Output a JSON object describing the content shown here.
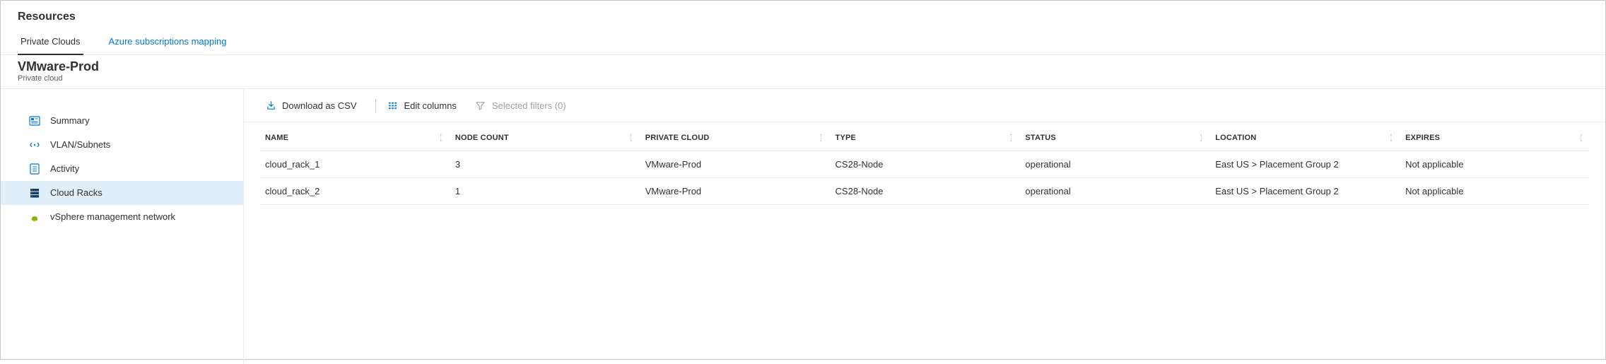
{
  "header": {
    "page_title": "Resources",
    "tabs": [
      {
        "label": "Private Clouds",
        "active": true
      },
      {
        "label": "Azure subscriptions mapping",
        "active": false
      }
    ],
    "resource_title": "VMware-Prod",
    "resource_subtitle": "Private cloud"
  },
  "sidebar": {
    "items": [
      {
        "label": "Summary",
        "icon": "summary-icon"
      },
      {
        "label": "VLAN/Subnets",
        "icon": "vlan-icon"
      },
      {
        "label": "Activity",
        "icon": "activity-icon"
      },
      {
        "label": "Cloud Racks",
        "icon": "rack-icon",
        "selected": true
      },
      {
        "label": "vSphere management network",
        "icon": "vsphere-icon"
      }
    ]
  },
  "toolbar": {
    "download_label": "Download as CSV",
    "edit_columns_label": "Edit columns",
    "filters_label": "Selected filters (0)"
  },
  "table": {
    "columns": [
      {
        "label": "NAME"
      },
      {
        "label": "NODE COUNT"
      },
      {
        "label": "PRIVATE CLOUD"
      },
      {
        "label": "TYPE"
      },
      {
        "label": "STATUS"
      },
      {
        "label": "LOCATION"
      },
      {
        "label": "EXPIRES"
      }
    ],
    "rows": [
      {
        "name": "cloud_rack_1",
        "node_count": "3",
        "private_cloud": "VMware-Prod",
        "type": "CS28-Node",
        "status": "operational",
        "location": "East US > Placement Group 2",
        "expires": "Not applicable"
      },
      {
        "name": "cloud_rack_2",
        "node_count": "1",
        "private_cloud": "VMware-Prod",
        "type": "CS28-Node",
        "status": "operational",
        "location": "East US > Placement Group 2",
        "expires": "Not applicable"
      }
    ]
  }
}
